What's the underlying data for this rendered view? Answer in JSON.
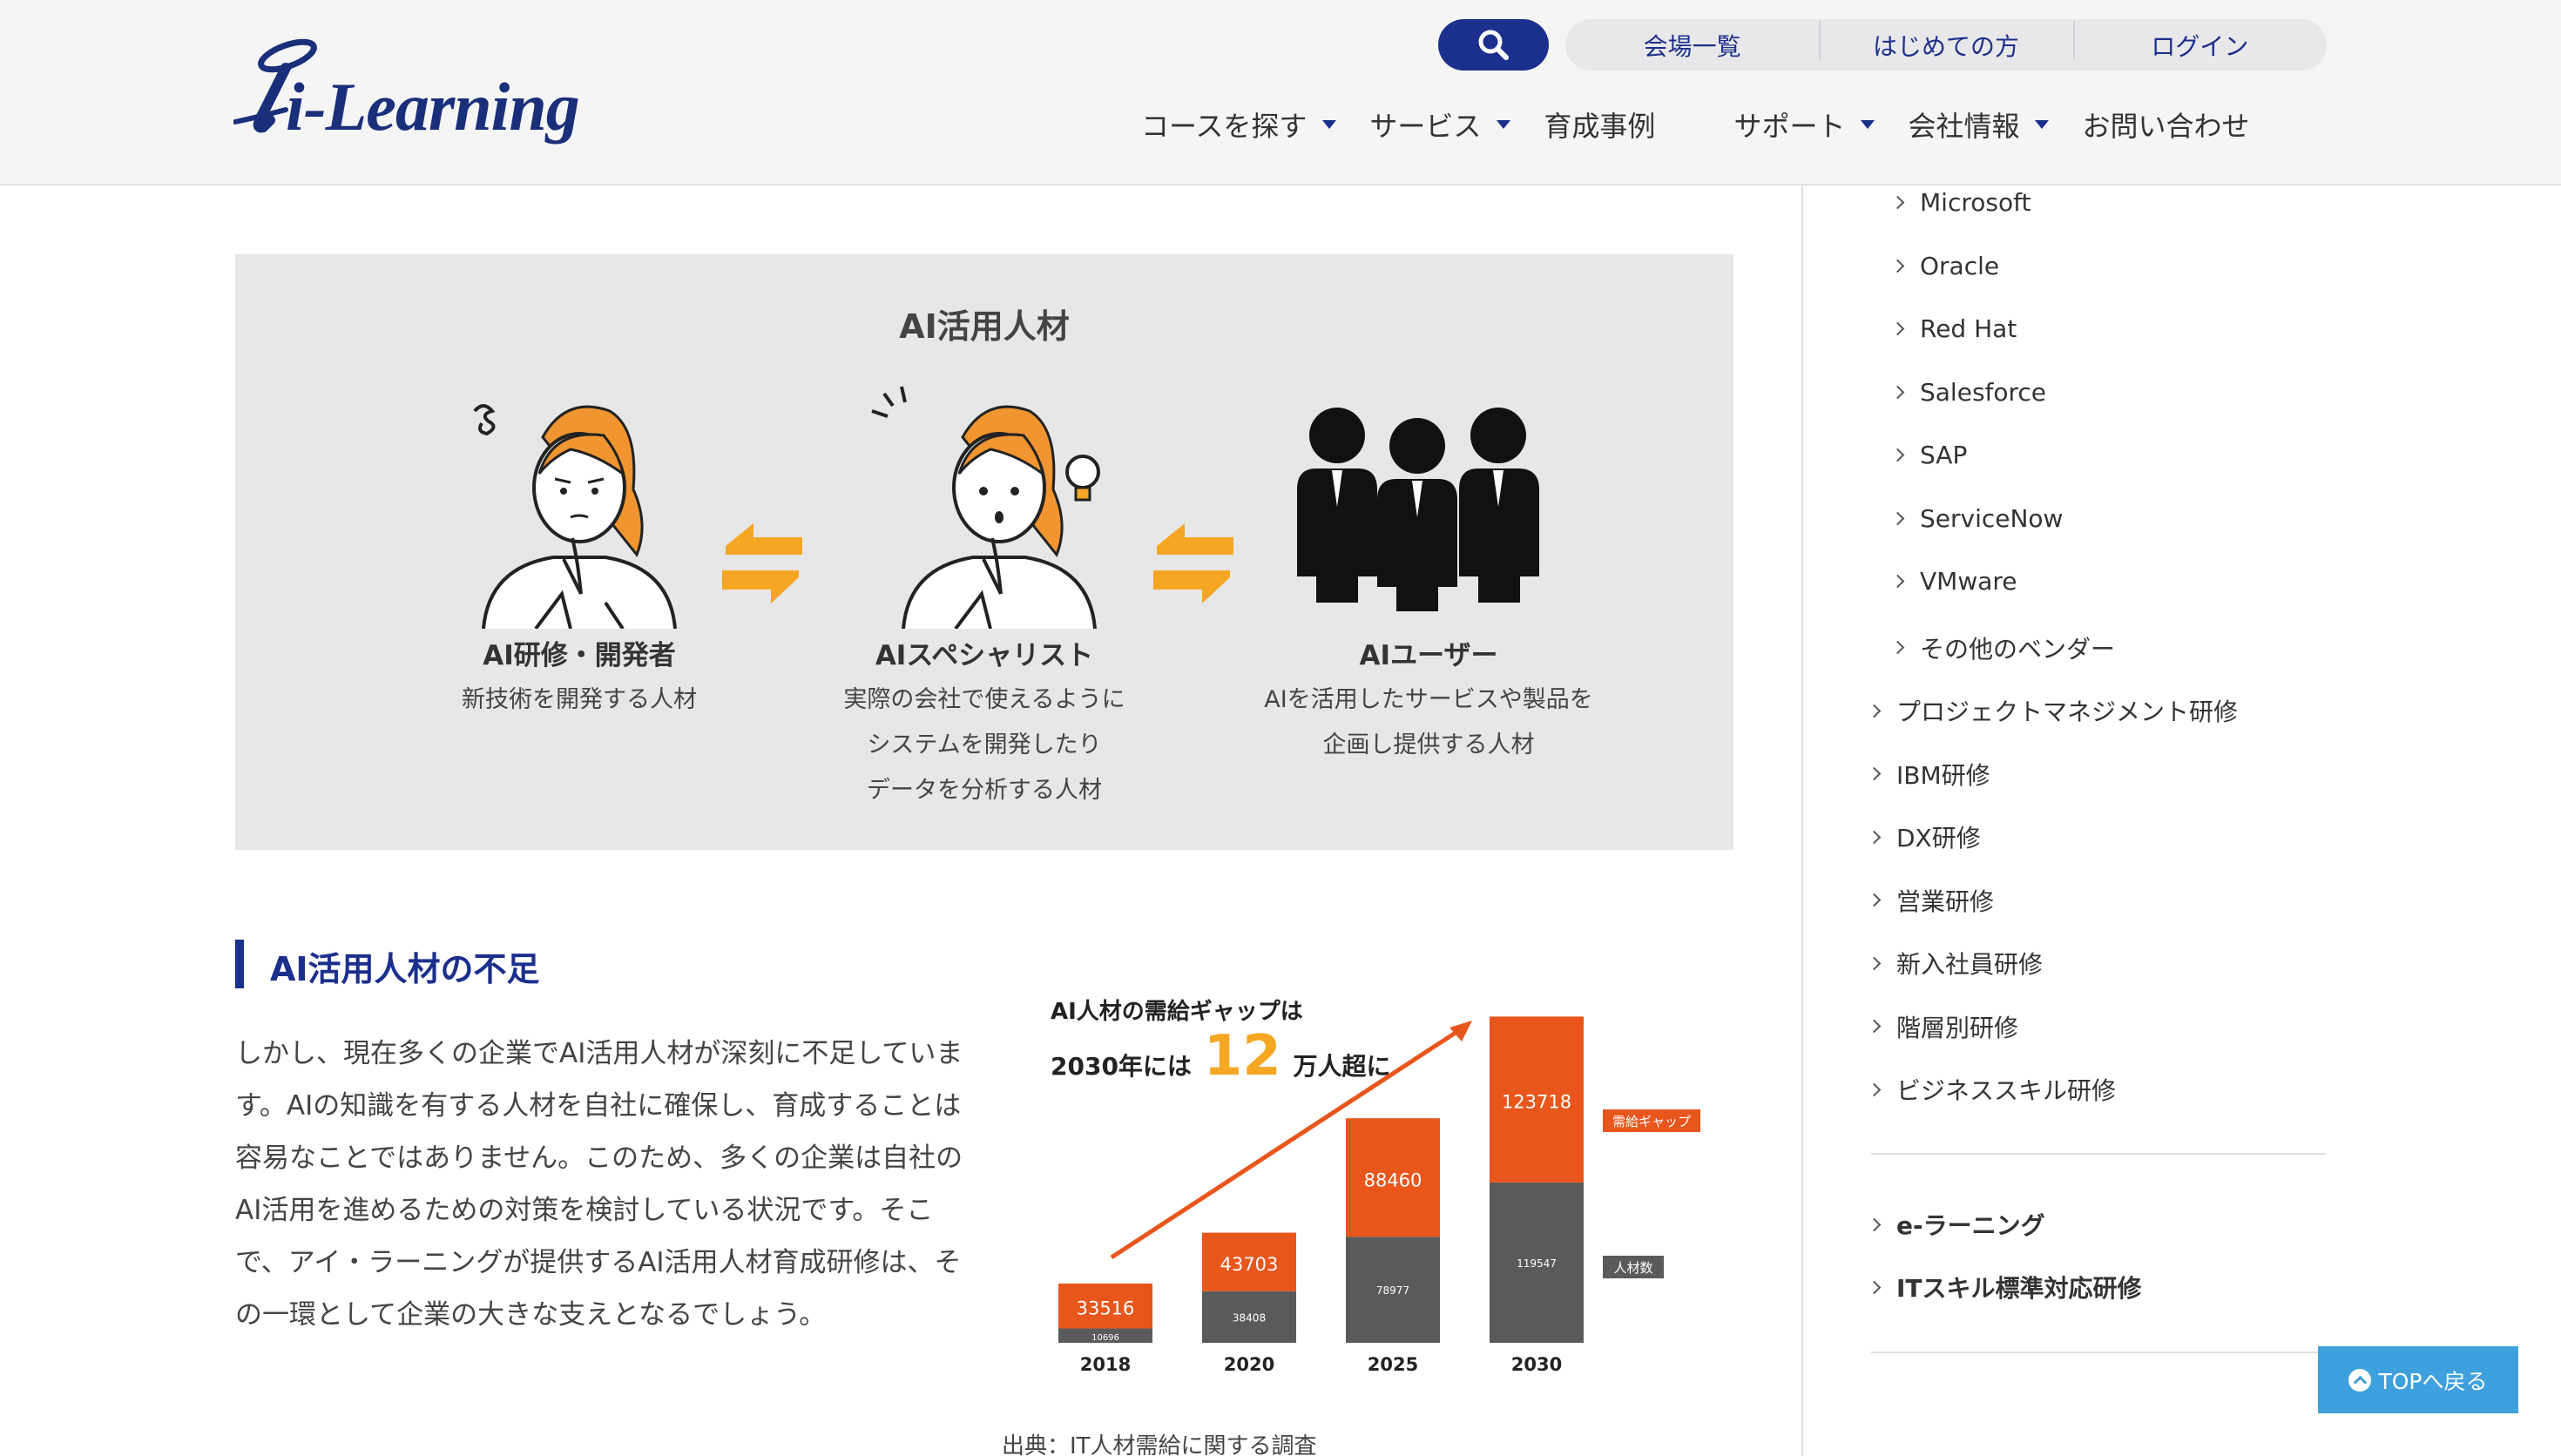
{
  "header": {
    "logo_text": "i-Learning",
    "util_links": [
      "会場一覧",
      "はじめての方",
      "ログイン"
    ],
    "nav": [
      {
        "label": "コースを探す",
        "dropdown": true
      },
      {
        "label": "サービス",
        "dropdown": true
      },
      {
        "label": "育成事例",
        "dropdown": false
      },
      {
        "label": "サポート",
        "dropdown": true
      },
      {
        "label": "会社情報",
        "dropdown": true
      },
      {
        "label": "お問い合わせ",
        "dropdown": false
      }
    ],
    "icons": {
      "search": "search-icon"
    },
    "colors": {
      "brand": "#1b2f8c",
      "accent": "#e8561c"
    }
  },
  "infographic": {
    "title": "AI活用人材",
    "personas": [
      {
        "name": "AI研修・開発者",
        "desc": [
          "新技術を開発する人材"
        ]
      },
      {
        "name": "AIスペシャリスト",
        "desc": [
          "実際の会社で使えるように",
          "システムを開発したり",
          "データを分析する人材"
        ]
      },
      {
        "name": "AIユーザー",
        "desc": [
          "AIを活用したサービスや製品を",
          "企画し提供する人材"
        ]
      }
    ]
  },
  "section": {
    "title": "AI活用人材の不足",
    "body": "しかし、現在多くの企業でAI活用人材が深刻に不足しています。AIの知識を有する人材を自社に確保し、育成することは容易なことではありません。このため、多くの企業は自社のAI活用を進めるための対策を検討している状況です。そこで、アイ・ラーニングが提供するAI活用人材育成研修は、その一環として企業の大きな支えとなるでしょう。",
    "source": "出典：IT人材需給に関する調査"
  },
  "chart_data": {
    "type": "bar",
    "title_line1": "AI人材の需給ギャップは",
    "title_line2_pre": "2030年には",
    "title_highlight": "12",
    "title_line2_post": "万人超に",
    "categories": [
      "2018",
      "2020",
      "2025",
      "2030"
    ],
    "series": [
      {
        "name": "人材数",
        "values": [
          10696,
          38408,
          78977,
          119547
        ],
        "color": "#5a5a5a"
      },
      {
        "name": "需給ギャップ",
        "values": [
          33516,
          43703,
          88460,
          123718
        ],
        "color": "#e8561c"
      }
    ],
    "trend_arrow_color": "#e8561c"
  },
  "sidebar": {
    "vendor_items": [
      "Microsoft",
      "Oracle",
      "Red Hat",
      "Salesforce",
      "SAP",
      "ServiceNow",
      "VMware",
      "その他のベンダー"
    ],
    "category_items": [
      "プロジェクトマネジメント研修",
      "IBM研修",
      "DX研修",
      "営業研修",
      "新入社員研修",
      "階層別研修",
      "ビジネススキル研修"
    ],
    "bold_items": [
      "e-ラーニング",
      "ITスキル標準対応研修"
    ]
  },
  "back_to_top": "TOPへ戻る"
}
